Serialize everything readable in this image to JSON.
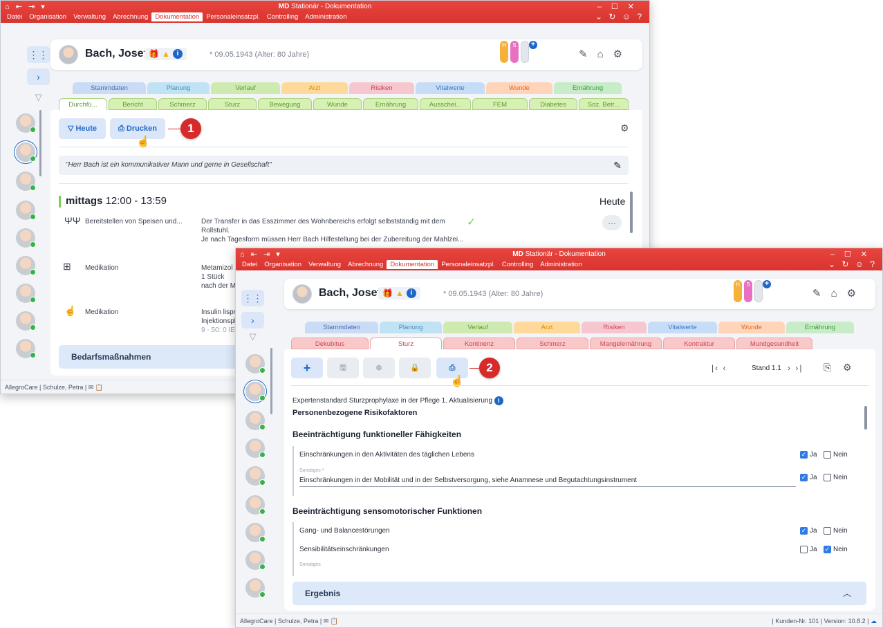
{
  "app": {
    "title_bold": "MD",
    "title_rest": "Stationär - Dokumentation",
    "menu": [
      "Datei",
      "Organisation",
      "Verwaltung",
      "Abrechnung",
      "Dokumentation",
      "Personaleinsatzpl.",
      "Controlling",
      "Administration"
    ],
    "active_menu": "Dokumentation"
  },
  "resident": {
    "name": "Bach, Josef",
    "dob": "* 09.05.1943 (Alter: 80 Jahre)",
    "tube_labels": [
      "H",
      "S"
    ]
  },
  "main_tabs": [
    "Stammdaten",
    "Planung",
    "Verlauf",
    "Arzt",
    "Risiken",
    "Vitalwerte",
    "Wunde",
    "Ernährung"
  ],
  "window1": {
    "subtabs": [
      "Durchfü...",
      "Bericht",
      "Schmerz",
      "Sturz",
      "Bewegung",
      "Wunde",
      "Ernährung",
      "Ausschei...",
      "FEM",
      "Diabetes",
      "Soz. Betr..."
    ],
    "buttons": {
      "today": "Heute",
      "print": "Drucken"
    },
    "callout": "1",
    "quote": "\"Herr Bach ist ein kommunikativer Mann und gerne in Gesellschaft\"",
    "section": {
      "label": "mittags",
      "time": "12:00 - 13:59",
      "today": "Heute"
    },
    "rows": [
      {
        "title": "Bereitstellen von Speisen und...",
        "lines": [
          "Der Transfer in das Esszimmer des Wohnbereichs erfolgt selbstständig mit dem",
          "Rollstuhl.",
          "Je nach Tagesform müssen Herr Bach Hilfestellung bei der Zubereitung der Mahlzei..."
        ]
      },
      {
        "title": "Medikation",
        "lines": [
          "Metamizol 5",
          "1 Stück",
          "nach der M"
        ]
      },
      {
        "title": "Medikation",
        "lines": [
          "Insulin lispr",
          "Injektionspl",
          "9 - 50: 0 IE..."
        ]
      }
    ],
    "accordion": "Bedarfsmaßnahmen",
    "status": "AllegroCare | Schulze, Petra |"
  },
  "window2": {
    "subtabs": [
      "Dekubitus",
      "Sturz",
      "Kontinenz",
      "Schmerz",
      "Mangelernährung",
      "Kontraktur",
      "Mundgesundheit"
    ],
    "active_subtab": "Sturz",
    "callout": "2",
    "stand": "Stand 1.1",
    "standard": "Expertenstandard Sturzprophylaxe in der Pflege 1. Aktualisierung",
    "heading": "Personenbezogene Risikofaktoren",
    "sections": [
      {
        "title": "Beeinträchtigung funktioneller Fähigkeiten",
        "items": [
          {
            "label": "Einschränkungen in den Aktivitäten des täglichen Lebens",
            "ja": true,
            "nein": false
          },
          {
            "caption": "Sonstiges *",
            "label": "Einschränkungen in der Mobilität und in der Selbstversorgung, siehe Anamnese und Begutachtungsinstrument",
            "ja": true,
            "nein": false
          }
        ]
      },
      {
        "title": "Beeinträchtigung sensomotorischer Funktionen",
        "items": [
          {
            "label": "Gang- und Balancestörungen",
            "ja": true,
            "nein": false
          },
          {
            "label": "Sensibilitätseinschränkungen",
            "ja": false,
            "nein": true
          },
          {
            "caption": "Sonstiges"
          }
        ]
      }
    ],
    "yes": "Ja",
    "no": "Nein",
    "result": "Ergebnis",
    "status_left": "AllegroCare | Schulze, Petra |",
    "status_right": "| Kunden-Nr. 101 | Version: 10.8.2 |"
  },
  "colors": {
    "brand_red": "#d9342f",
    "accent_blue": "#1f67c7",
    "callout_red": "#d72a2a"
  }
}
